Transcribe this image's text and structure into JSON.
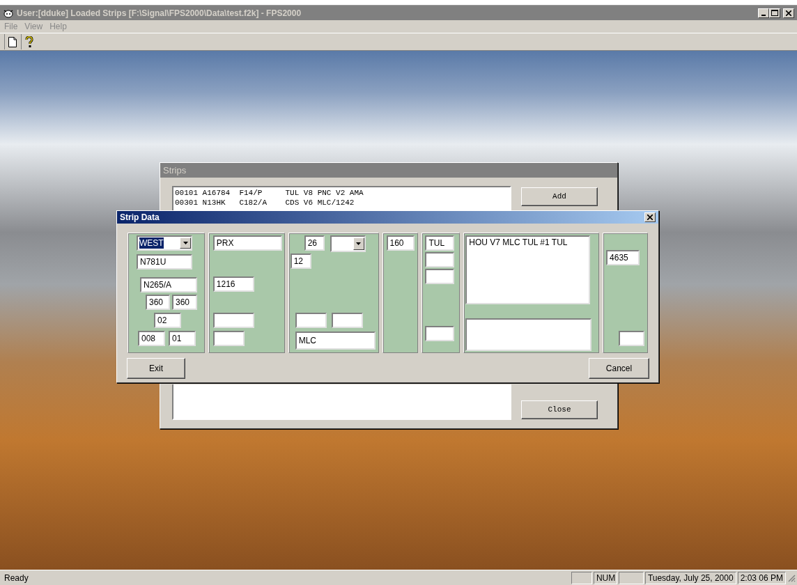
{
  "window": {
    "title": "User:[dduke] Loaded Strips [F:\\Signal\\FPS2000\\Data\\test.f2k] - FPS2000",
    "active": false
  },
  "menu": [
    "File",
    "View",
    "Help"
  ],
  "strips_window": {
    "title": "Strips",
    "active": false,
    "list_rows": [
      "00101 A16784  F14/P     TUL V8 PNC V2 AMA",
      "00301 N13HK   C182/A    CDS V6 MLC/1242"
    ],
    "add_button": "Add",
    "close_button": "Close"
  },
  "strip_data": {
    "title": "Strip Data",
    "active": true,
    "panels": [
      {
        "fields": [
          {
            "kind": "combo",
            "value": "WEST",
            "highlighted": true
          },
          {
            "kind": "text",
            "value": "N781U"
          },
          {
            "kind": "text",
            "value": "N265/A"
          },
          {
            "kind": "text",
            "value": "360"
          },
          {
            "kind": "text",
            "value": "360"
          },
          {
            "kind": "text",
            "value": "02"
          },
          {
            "kind": "text",
            "value": "008"
          },
          {
            "kind": "text",
            "value": "01"
          }
        ]
      },
      {
        "fields": [
          {
            "kind": "text",
            "value": "PRX"
          },
          {
            "kind": "text",
            "value": "1216"
          },
          {
            "kind": "text"
          },
          {
            "kind": "text"
          }
        ]
      },
      {
        "fields": [
          {
            "kind": "text",
            "value": "26"
          },
          {
            "kind": "combo"
          },
          {
            "kind": "text",
            "value": "12"
          },
          {
            "kind": "text"
          },
          {
            "kind": "text"
          },
          {
            "kind": "text",
            "value": "MLC"
          }
        ]
      },
      {
        "fields": [
          {
            "kind": "text",
            "value": "160"
          }
        ]
      },
      {
        "fields": [
          {
            "kind": "text",
            "value": "TUL"
          },
          {
            "kind": "text"
          },
          {
            "kind": "text"
          },
          {
            "kind": "text"
          }
        ]
      },
      {
        "fields": [
          {
            "kind": "memo",
            "value": "HOU V7 MLC TUL #1 TUL"
          },
          {
            "kind": "memo"
          }
        ]
      },
      {
        "fields": [
          {
            "kind": "text",
            "value": "4635"
          },
          {
            "kind": "text"
          }
        ]
      }
    ],
    "exit_button": "Exit",
    "cancel_button": "Cancel"
  },
  "status_bar": {
    "message": "Ready",
    "indicator": "NUM",
    "date": "Tuesday, July 25, 2000",
    "time": "2:03 06 PM"
  }
}
